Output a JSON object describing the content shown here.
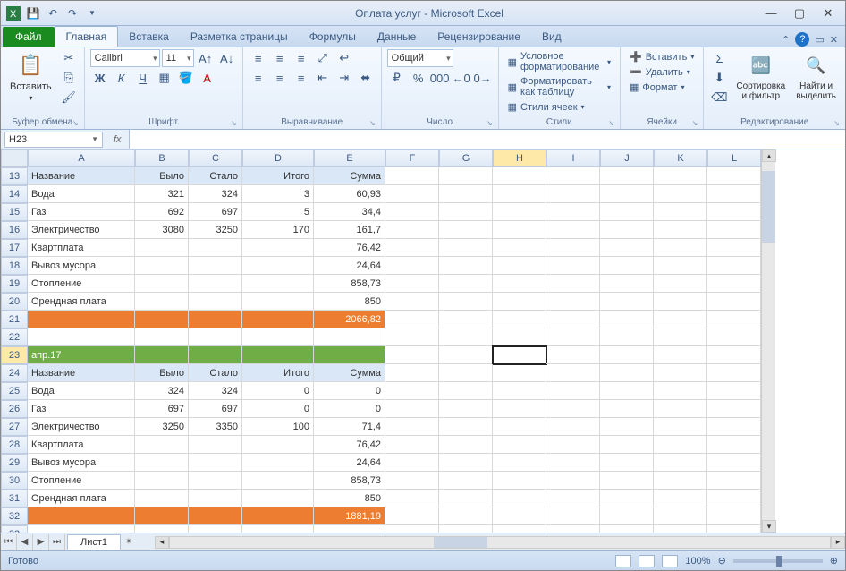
{
  "titlebar": {
    "title": "Оплата услуг - Microsoft Excel"
  },
  "ribbon": {
    "file": "Файл",
    "tabs": [
      "Главная",
      "Вставка",
      "Разметка страницы",
      "Формулы",
      "Данные",
      "Рецензирование",
      "Вид"
    ],
    "activeTab": 0,
    "clipboard": {
      "paste": "Вставить",
      "label": "Буфер обмена"
    },
    "font": {
      "name": "Calibri",
      "size": "11",
      "label": "Шрифт"
    },
    "align": {
      "label": "Выравнивание"
    },
    "number": {
      "format": "Общий",
      "label": "Число"
    },
    "styles": {
      "cond": "Условное форматирование",
      "table": "Форматировать как таблицу",
      "cell": "Стили ячеек",
      "label": "Стили"
    },
    "cells": {
      "insert": "Вставить",
      "delete": "Удалить",
      "format": "Формат",
      "label": "Ячейки"
    },
    "editing": {
      "sort": "Сортировка и фильтр",
      "find": "Найти и выделить",
      "label": "Редактирование"
    }
  },
  "formula": {
    "namebox": "H23",
    "fx": "fx",
    "value": ""
  },
  "grid": {
    "cols": [
      "A",
      "B",
      "C",
      "D",
      "E",
      "F",
      "G",
      "H",
      "I",
      "J",
      "K",
      "L"
    ],
    "activeCol": "H",
    "rowStart": 13,
    "activeRow": 23,
    "rows": [
      {
        "n": 13,
        "style": "hdr",
        "c": [
          "Название",
          "Было",
          "Стало",
          "Итого",
          "Сумма"
        ],
        "align": [
          "l",
          "r",
          "r",
          "r",
          "r"
        ]
      },
      {
        "n": 14,
        "c": [
          "Вода",
          "321",
          "324",
          "3",
          "60,93"
        ],
        "align": [
          "l",
          "r",
          "r",
          "r",
          "r"
        ]
      },
      {
        "n": 15,
        "c": [
          "Газ",
          "692",
          "697",
          "5",
          "34,4"
        ],
        "align": [
          "l",
          "r",
          "r",
          "r",
          "r"
        ]
      },
      {
        "n": 16,
        "c": [
          "Электричество",
          "3080",
          "3250",
          "170",
          "161,7"
        ],
        "align": [
          "l",
          "r",
          "r",
          "r",
          "r"
        ]
      },
      {
        "n": 17,
        "c": [
          "Квартплата",
          "",
          "",
          "",
          "76,42"
        ],
        "align": [
          "l",
          "r",
          "r",
          "r",
          "r"
        ]
      },
      {
        "n": 18,
        "c": [
          "Вывоз мусора",
          "",
          "",
          "",
          "24,64"
        ],
        "align": [
          "l",
          "r",
          "r",
          "r",
          "r"
        ]
      },
      {
        "n": 19,
        "c": [
          "Отопление",
          "",
          "",
          "",
          "858,73"
        ],
        "align": [
          "l",
          "r",
          "r",
          "r",
          "r"
        ]
      },
      {
        "n": 20,
        "c": [
          "Орендная плата",
          "",
          "",
          "",
          "850"
        ],
        "align": [
          "l",
          "r",
          "r",
          "r",
          "r"
        ]
      },
      {
        "n": 21,
        "style": "orange",
        "c": [
          "",
          "",
          "",
          "",
          "2066,82"
        ],
        "align": [
          "l",
          "r",
          "r",
          "r",
          "r"
        ]
      },
      {
        "n": 22,
        "c": [
          "",
          "",
          "",
          "",
          ""
        ]
      },
      {
        "n": 23,
        "style": "green",
        "c": [
          "апр.17",
          "",
          "",
          "",
          ""
        ],
        "align": [
          "l"
        ]
      },
      {
        "n": 24,
        "style": "hdr",
        "c": [
          "Название",
          "Было",
          "Стало",
          "Итого",
          "Сумма"
        ],
        "align": [
          "l",
          "r",
          "r",
          "r",
          "r"
        ]
      },
      {
        "n": 25,
        "c": [
          "Вода",
          "324",
          "324",
          "0",
          "0"
        ],
        "align": [
          "l",
          "r",
          "r",
          "r",
          "r"
        ]
      },
      {
        "n": 26,
        "c": [
          "Газ",
          "697",
          "697",
          "0",
          "0"
        ],
        "align": [
          "l",
          "r",
          "r",
          "r",
          "r"
        ]
      },
      {
        "n": 27,
        "c": [
          "Электричество",
          "3250",
          "3350",
          "100",
          "71,4"
        ],
        "align": [
          "l",
          "r",
          "r",
          "r",
          "r"
        ]
      },
      {
        "n": 28,
        "c": [
          "Квартплата",
          "",
          "",
          "",
          "76,42"
        ],
        "align": [
          "l",
          "r",
          "r",
          "r",
          "r"
        ]
      },
      {
        "n": 29,
        "c": [
          "Вывоз мусора",
          "",
          "",
          "",
          "24,64"
        ],
        "align": [
          "l",
          "r",
          "r",
          "r",
          "r"
        ]
      },
      {
        "n": 30,
        "c": [
          "Отопление",
          "",
          "",
          "",
          "858,73"
        ],
        "align": [
          "l",
          "r",
          "r",
          "r",
          "r"
        ]
      },
      {
        "n": 31,
        "c": [
          "Орендная плата",
          "",
          "",
          "",
          "850"
        ],
        "align": [
          "l",
          "r",
          "r",
          "r",
          "r"
        ]
      },
      {
        "n": 32,
        "style": "orange",
        "c": [
          "",
          "",
          "",
          "",
          "1881,19"
        ],
        "align": [
          "l",
          "r",
          "r",
          "r",
          "r"
        ]
      },
      {
        "n": 33,
        "c": [
          "",
          "",
          "",
          "",
          ""
        ]
      }
    ]
  },
  "sheets": {
    "active": "Лист1"
  },
  "status": {
    "ready": "Готово",
    "zoom": "100%"
  }
}
